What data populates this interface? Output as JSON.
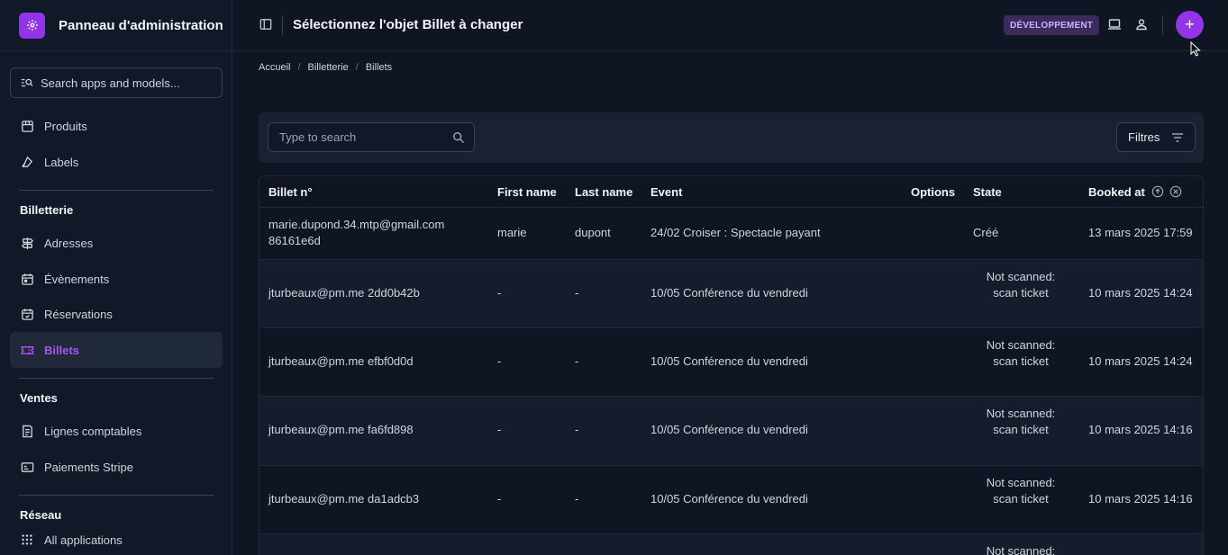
{
  "app": {
    "title": "Panneau d'administration"
  },
  "sidebar": {
    "search_placeholder": "Search apps and models...",
    "items": [
      {
        "label": "Produits",
        "icon": "store-icon"
      },
      {
        "label": "Labels",
        "icon": "tag-icon"
      }
    ],
    "sections": [
      {
        "title": "Billetterie",
        "items": [
          {
            "label": "Adresses",
            "icon": "signpost-icon"
          },
          {
            "label": "Évènements",
            "icon": "calendar-icon"
          },
          {
            "label": "Réservations",
            "icon": "booking-icon"
          },
          {
            "label": "Billets",
            "icon": "ticket-icon",
            "active": true
          }
        ]
      },
      {
        "title": "Ventes",
        "items": [
          {
            "label": "Lignes comptables",
            "icon": "ledger-icon"
          },
          {
            "label": "Paiements Stripe",
            "icon": "card-icon"
          }
        ]
      },
      {
        "title": "Réseau",
        "items": [
          {
            "label": "All applications",
            "icon": "apps-grid-icon"
          }
        ]
      }
    ]
  },
  "header": {
    "page_title": "Sélectionnez l'objet Billet à changer",
    "env_badge": "DÉVELOPPEMENT",
    "add_label": "+"
  },
  "breadcrumb": [
    "Accueil",
    "Billetterie",
    "Billets"
  ],
  "toolbar": {
    "search_placeholder": "Type to search",
    "filters_label": "Filtres"
  },
  "table": {
    "columns": [
      "Billet n°",
      "First name",
      "Last name",
      "Event",
      "Options",
      "State",
      "Booked at"
    ],
    "rows": [
      {
        "billet_line1": "marie.dupond.34.mtp@gmail.com",
        "billet_line2": "86161e6d",
        "first_name": "marie",
        "last_name": "dupont",
        "event": "24/02 Croiser : Spectacle payant",
        "options": "",
        "state_line1": "Créé",
        "state_line2": "",
        "booked_at": "13 mars 2025 17:59"
      },
      {
        "billet_line1": "jturbeaux@pm.me 2dd0b42b",
        "billet_line2": "",
        "first_name": "-",
        "last_name": "-",
        "event": "10/05 Conférence du vendredi",
        "options": "",
        "state_line1": "Not scanned:",
        "state_line2": "scan ticket",
        "booked_at": "10 mars 2025 14:24"
      },
      {
        "billet_line1": "jturbeaux@pm.me efbf0d0d",
        "billet_line2": "",
        "first_name": "-",
        "last_name": "-",
        "event": "10/05 Conférence du vendredi",
        "options": "",
        "state_line1": "Not scanned:",
        "state_line2": "scan ticket",
        "booked_at": "10 mars 2025 14:24"
      },
      {
        "billet_line1": "jturbeaux@pm.me fa6fd898",
        "billet_line2": "",
        "first_name": "-",
        "last_name": "-",
        "event": "10/05 Conférence du vendredi",
        "options": "",
        "state_line1": "Not scanned:",
        "state_line2": "scan ticket",
        "booked_at": "10 mars 2025 14:16"
      },
      {
        "billet_line1": "jturbeaux@pm.me da1adcb3",
        "billet_line2": "",
        "first_name": "-",
        "last_name": "-",
        "event": "10/05 Conférence du vendredi",
        "options": "",
        "state_line1": "Not scanned:",
        "state_line2": "scan ticket",
        "booked_at": "10 mars 2025 14:16"
      },
      {
        "billet_line1": "",
        "billet_line2": "",
        "first_name": "",
        "last_name": "",
        "event": "",
        "options": "",
        "state_line1": "Not scanned:",
        "state_line2": "",
        "booked_at": ""
      }
    ]
  },
  "colors": {
    "accent": "#9333ea",
    "background": "#0f1523",
    "active_text": "#a855f7"
  }
}
